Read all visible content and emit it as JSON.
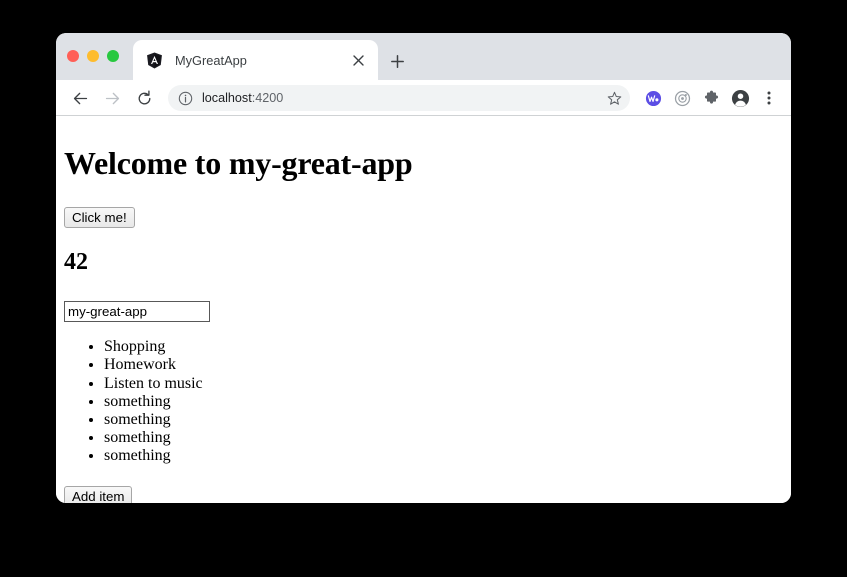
{
  "window": {
    "traffic_lights": [
      {
        "name": "close",
        "color": "#ff5f57"
      },
      {
        "name": "minimize",
        "color": "#febc2e"
      },
      {
        "name": "maximize",
        "color": "#28c840"
      }
    ]
  },
  "tabs": {
    "active": {
      "title": "MyGreatApp",
      "favicon": "angular-logo-icon",
      "close_icon": "close-icon"
    },
    "new_tab_icon": "plus-icon"
  },
  "toolbar": {
    "back_icon": "back-arrow-icon",
    "forward_icon": "forward-arrow-icon",
    "reload_icon": "reload-icon",
    "site_info_icon": "info-circle-icon",
    "url_host": "localhost",
    "url_port": ":4200",
    "url_full": "localhost:4200",
    "bookmark_icon": "star-icon",
    "extension_icons": [
      {
        "name": "wappalyzer-extension-icon",
        "color": "#5c4ee5"
      },
      {
        "name": "augury-extension-icon",
        "color": "#9aa0a6"
      },
      {
        "name": "extensions-puzzle-icon",
        "color": "#5f6368"
      }
    ],
    "profile_icon": "account-avatar-icon",
    "menu_icon": "three-dot-menu-icon"
  },
  "page": {
    "heading": "Welcome to my-great-app",
    "click_button_label": "Click me!",
    "counter_value": "42",
    "name_input_value": "my-great-app",
    "name_input_placeholder": "",
    "todo_items": [
      "Shopping",
      "Homework",
      "Listen to music",
      "something",
      "something",
      "something",
      "something"
    ],
    "add_item_label": "Add item"
  }
}
